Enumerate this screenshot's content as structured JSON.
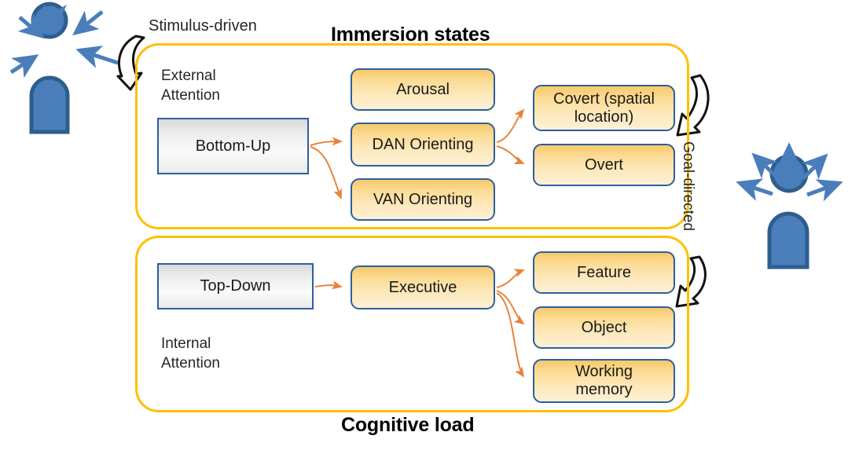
{
  "diagram": {
    "titles": {
      "top": "Immersion states",
      "bottom": "Cognitive load"
    },
    "edge_labels": {
      "stimulus_driven": "Stimulus-driven",
      "goal_directed": "Goal-directed"
    },
    "bands": [
      {
        "id": "external",
        "label": "External\nAttention",
        "source_node": "Bottom-Up",
        "mid_nodes": [
          "Arousal",
          "DAN Orienting",
          "VAN Orienting"
        ],
        "leaf_nodes": [
          "Covert (spatial location)",
          "Overt"
        ]
      },
      {
        "id": "internal",
        "label": "Internal\nAttention",
        "source_node": "Top-Down",
        "mid_nodes": [
          "Executive"
        ],
        "leaf_nodes": [
          "Feature",
          "Object",
          "Working memory"
        ]
      }
    ],
    "nodes": {
      "bottom_up": "Bottom-Up",
      "arousal": "Arousal",
      "dan_orienting": "DAN Orienting",
      "van_orienting": "VAN Orienting",
      "covert": "Covert (spatial\nlocation)",
      "overt": "Overt",
      "top_down": "Top-Down",
      "executive": "Executive",
      "feature": "Feature",
      "object": "Object",
      "working_memory": "Working\nmemory"
    },
    "labels": {
      "external_attention": "External\nAttention",
      "internal_attention": "Internal\nAttention"
    },
    "icons": {
      "left_person": "person-incoming-arrows-icon",
      "right_person": "person-outgoing-arrows-icon"
    },
    "colors": {
      "band_border": "#FFC000",
      "node_border": "#2E5E9E",
      "node_gold_top": "#F7C96B",
      "node_gold_bottom": "#FDF0D4",
      "node_grey_top": "#D9D9D9",
      "node_grey_bottom": "#EAEAEA",
      "connector_orange": "#E8833A",
      "person_blue": "#4A7EBB",
      "person_blue_dark": "#2E5E8E",
      "title_black": "#000000"
    }
  }
}
